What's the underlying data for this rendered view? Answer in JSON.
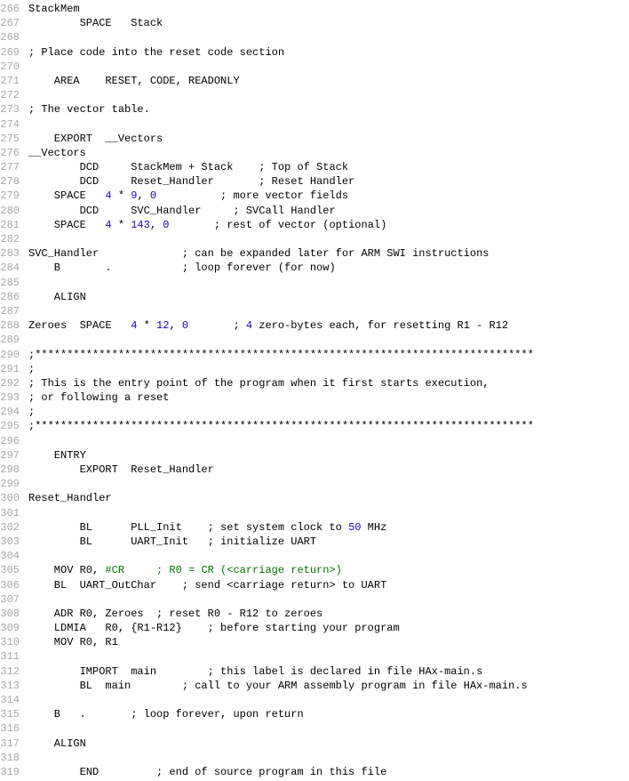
{
  "lines": [
    {
      "n": 266,
      "segments": [
        {
          "t": "StackMem"
        }
      ]
    },
    {
      "n": 267,
      "segments": [
        {
          "t": "        SPACE   Stack"
        }
      ]
    },
    {
      "n": 268,
      "segments": [
        {
          "t": ""
        }
      ]
    },
    {
      "n": 269,
      "segments": [
        {
          "t": "; Place code into the reset code section"
        }
      ]
    },
    {
      "n": 270,
      "segments": [
        {
          "t": ""
        }
      ]
    },
    {
      "n": 271,
      "segments": [
        {
          "t": "    AREA    RESET, CODE, READONLY"
        }
      ]
    },
    {
      "n": 272,
      "segments": [
        {
          "t": ""
        }
      ]
    },
    {
      "n": 273,
      "segments": [
        {
          "t": "; The vector table."
        }
      ]
    },
    {
      "n": 274,
      "segments": [
        {
          "t": ""
        }
      ]
    },
    {
      "n": 275,
      "segments": [
        {
          "t": "    EXPORT  __Vectors"
        }
      ]
    },
    {
      "n": 276,
      "segments": [
        {
          "t": "__Vectors"
        }
      ]
    },
    {
      "n": 277,
      "segments": [
        {
          "t": "        DCD     StackMem + Stack    ; Top of Stack"
        }
      ]
    },
    {
      "n": 278,
      "segments": [
        {
          "t": "        DCD     Reset_Handler       ; Reset Handler"
        }
      ]
    },
    {
      "n": 279,
      "segments": [
        {
          "t": "    SPACE   "
        },
        {
          "t": "4",
          "c": "kw-blue"
        },
        {
          "t": " * "
        },
        {
          "t": "9",
          "c": "kw-blue"
        },
        {
          "t": ", "
        },
        {
          "t": "0",
          "c": "kw-blue"
        },
        {
          "t": "          ; more vector fields"
        }
      ]
    },
    {
      "n": 280,
      "segments": [
        {
          "t": "        DCD     SVC_Handler     ; SVCall Handler"
        }
      ]
    },
    {
      "n": 281,
      "segments": [
        {
          "t": "    SPACE   "
        },
        {
          "t": "4",
          "c": "kw-blue"
        },
        {
          "t": " * "
        },
        {
          "t": "143",
          "c": "kw-blue"
        },
        {
          "t": ", "
        },
        {
          "t": "0",
          "c": "kw-blue"
        },
        {
          "t": "       ; rest of vector (optional)"
        }
      ]
    },
    {
      "n": 282,
      "segments": [
        {
          "t": ""
        }
      ]
    },
    {
      "n": 283,
      "segments": [
        {
          "t": "SVC_Handler             ; can be expanded later for ARM SWI instructions"
        }
      ]
    },
    {
      "n": 284,
      "segments": [
        {
          "t": "    B       .           ; loop forever (for now)"
        }
      ]
    },
    {
      "n": 285,
      "segments": [
        {
          "t": ""
        }
      ]
    },
    {
      "n": 286,
      "segments": [
        {
          "t": "    ALIGN"
        }
      ]
    },
    {
      "n": 287,
      "segments": [
        {
          "t": ""
        }
      ]
    },
    {
      "n": 288,
      "segments": [
        {
          "t": "Zeroes  SPACE   "
        },
        {
          "t": "4",
          "c": "kw-blue"
        },
        {
          "t": " * "
        },
        {
          "t": "12",
          "c": "kw-blue"
        },
        {
          "t": ", "
        },
        {
          "t": "0",
          "c": "kw-blue"
        },
        {
          "t": "       ; "
        },
        {
          "t": "4",
          "c": "kw-blue"
        },
        {
          "t": " zero-bytes each, for resetting R1 - R12"
        }
      ]
    },
    {
      "n": 289,
      "segments": [
        {
          "t": ""
        }
      ]
    },
    {
      "n": 290,
      "segments": [
        {
          "t": ";******************************************************************************"
        }
      ]
    },
    {
      "n": 291,
      "segments": [
        {
          "t": ";"
        }
      ]
    },
    {
      "n": 292,
      "segments": [
        {
          "t": "; This is the entry point of the program when it first starts execution,"
        }
      ]
    },
    {
      "n": 293,
      "segments": [
        {
          "t": "; or following a reset"
        }
      ]
    },
    {
      "n": 294,
      "segments": [
        {
          "t": ";"
        }
      ]
    },
    {
      "n": 295,
      "segments": [
        {
          "t": ";******************************************************************************"
        }
      ]
    },
    {
      "n": 296,
      "segments": [
        {
          "t": ""
        }
      ]
    },
    {
      "n": 297,
      "segments": [
        {
          "t": "    ENTRY"
        }
      ]
    },
    {
      "n": 298,
      "segments": [
        {
          "t": "        EXPORT  Reset_Handler"
        }
      ]
    },
    {
      "n": 299,
      "segments": [
        {
          "t": ""
        }
      ]
    },
    {
      "n": 300,
      "segments": [
        {
          "t": "Reset_Handler"
        }
      ]
    },
    {
      "n": 301,
      "segments": [
        {
          "t": ""
        }
      ]
    },
    {
      "n": 302,
      "segments": [
        {
          "t": "        BL      PLL_Init    ; set system clock to "
        },
        {
          "t": "50",
          "c": "kw-blue"
        },
        {
          "t": " MHz"
        }
      ]
    },
    {
      "n": 303,
      "segments": [
        {
          "t": "        BL      UART_Init   ; initialize UART"
        }
      ]
    },
    {
      "n": 304,
      "segments": [
        {
          "t": ""
        }
      ]
    },
    {
      "n": 305,
      "segments": [
        {
          "t": "    MOV R0, "
        },
        {
          "t": "#CR     ; R0 = CR (<carriage return>)",
          "c": "kw-green"
        }
      ]
    },
    {
      "n": 306,
      "segments": [
        {
          "t": "    BL  UART_OutChar    ; send <carriage return> to UART"
        }
      ]
    },
    {
      "n": 307,
      "segments": [
        {
          "t": ""
        }
      ]
    },
    {
      "n": 308,
      "segments": [
        {
          "t": "    ADR R0, Zeroes  ; reset R0 - R12 to zeroes"
        }
      ]
    },
    {
      "n": 309,
      "segments": [
        {
          "t": "    LDMIA   R0, {R1-R12}    ; before starting your program"
        }
      ]
    },
    {
      "n": 310,
      "segments": [
        {
          "t": "    MOV R0, R1"
        }
      ]
    },
    {
      "n": 311,
      "segments": [
        {
          "t": ""
        }
      ]
    },
    {
      "n": 312,
      "segments": [
        {
          "t": "        IMPORT  main        ; this label is declared in file HAx-main.s"
        }
      ]
    },
    {
      "n": 313,
      "segments": [
        {
          "t": "        BL  main        ; call to your ARM assembly program in file HAx-main.s"
        }
      ]
    },
    {
      "n": 314,
      "segments": [
        {
          "t": ""
        }
      ]
    },
    {
      "n": 315,
      "segments": [
        {
          "t": "    B   .       ; loop forever, upon return"
        }
      ]
    },
    {
      "n": 316,
      "segments": [
        {
          "t": ""
        }
      ]
    },
    {
      "n": 317,
      "segments": [
        {
          "t": "    ALIGN"
        }
      ]
    },
    {
      "n": 318,
      "segments": [
        {
          "t": ""
        }
      ]
    },
    {
      "n": 319,
      "segments": [
        {
          "t": "        END         ; end of source program in this file"
        }
      ]
    }
  ]
}
